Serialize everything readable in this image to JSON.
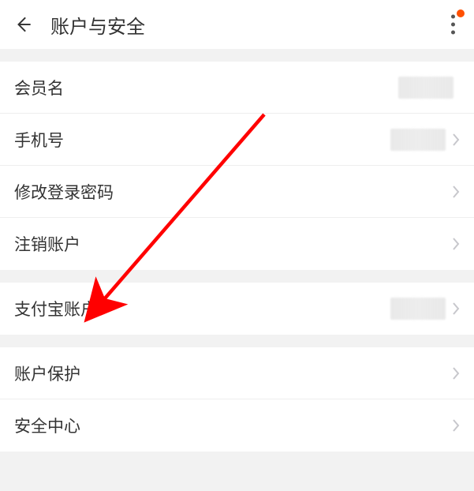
{
  "header": {
    "title": "账户与安全"
  },
  "group1": {
    "member_name_label": "会员名",
    "phone_label": "手机号",
    "change_password_label": "修改登录密码",
    "deactivate_label": "注销账户"
  },
  "group2": {
    "alipay_label": "支付宝账户"
  },
  "group3": {
    "account_protection_label": "账户保护",
    "security_center_label": "安全中心"
  }
}
